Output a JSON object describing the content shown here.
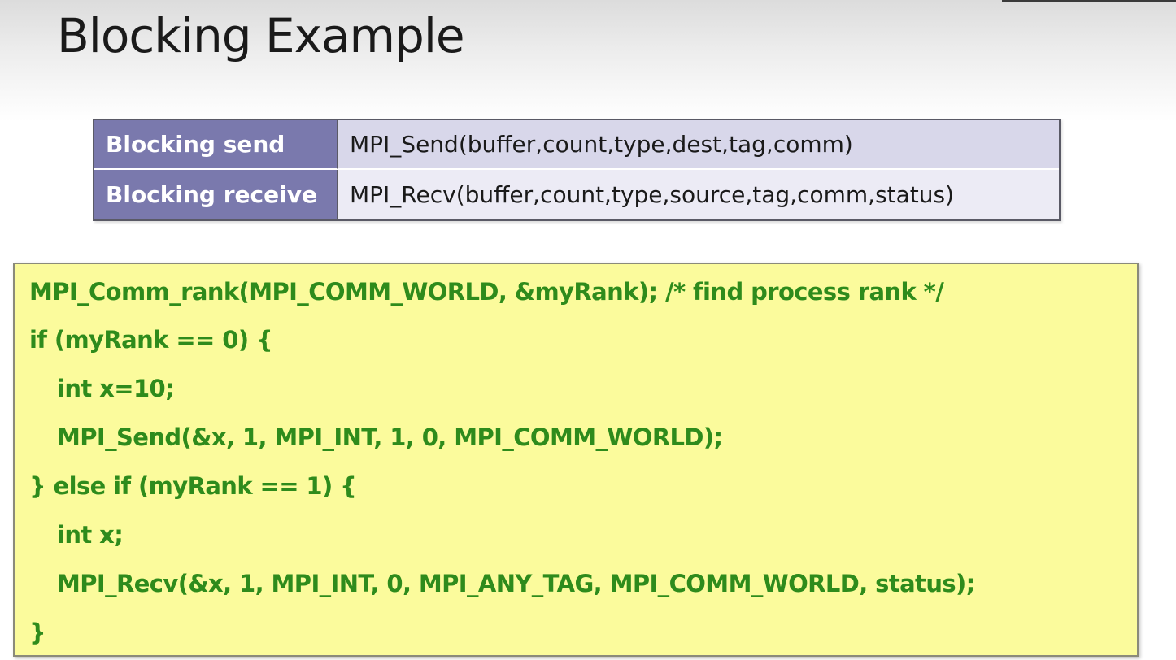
{
  "slide": {
    "title": "Blocking Example"
  },
  "api_table": {
    "rows": [
      {
        "label": "Blocking send",
        "signature": "MPI_Send(buffer,count,type,dest,tag,comm)"
      },
      {
        "label": "Blocking receive",
        "signature": "MPI_Recv(buffer,count,type,source,tag,comm,status)"
      }
    ]
  },
  "code": {
    "lines": [
      "MPI_Comm_rank(MPI_COMM_WORLD, &myRank); /* find process rank */",
      "if (myRank == 0) {",
      "int x=10;",
      "MPI_Send(&x, 1, MPI_INT, 1, 0, MPI_COMM_WORLD);",
      "} else if (myRank == 1) {",
      "int x;",
      "MPI_Recv(&x, 1, MPI_INT, 0, MPI_ANY_TAG, MPI_COMM_WORLD, status);",
      "}"
    ]
  },
  "colors": {
    "table_header": "#7a79ad",
    "table_row1": "#d8d7ea",
    "table_row2": "#ecebf5",
    "code_background": "#fbfb9c",
    "code_text": "#2e8b1c"
  }
}
